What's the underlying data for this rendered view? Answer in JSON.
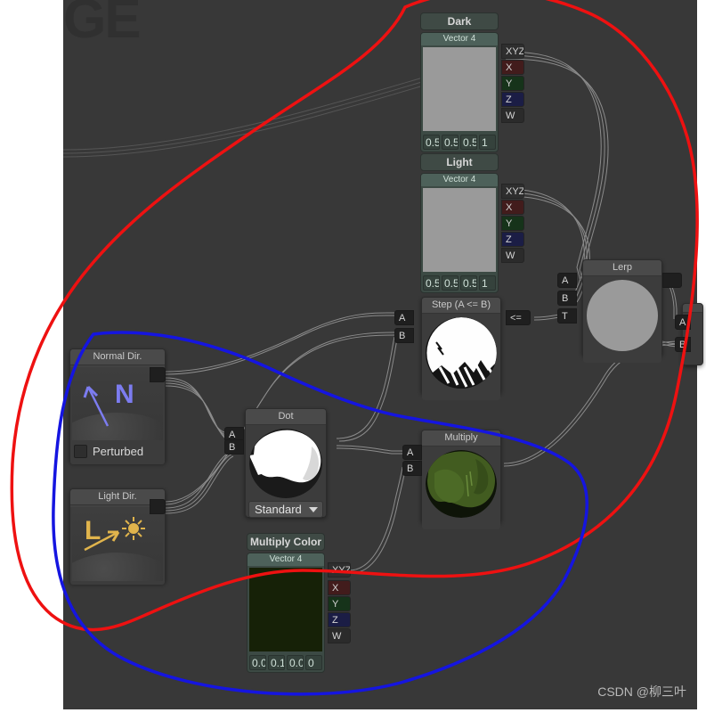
{
  "canvas": {
    "background_color": "#383838",
    "watermark_ge": "GE",
    "watermark_csdn": "CSDN @柳三叶"
  },
  "annotations": {
    "red_color": "#ee1111",
    "blue_color": "#1515e0"
  },
  "nodes": {
    "dark": {
      "title": "Dark",
      "subtitle": "Vector 4",
      "fields": [
        "0.5",
        "0.5",
        "0.5",
        "1"
      ],
      "outputs": [
        "XYZ",
        "X",
        "Y",
        "Z",
        "W"
      ]
    },
    "light": {
      "title": "Light",
      "subtitle": "Vector 4",
      "fields": [
        "0.5",
        "0.5",
        "0.5",
        "1"
      ],
      "outputs": [
        "XYZ",
        "X",
        "Y",
        "Z",
        "W"
      ]
    },
    "multiply_color": {
      "title": "Multiply Color",
      "subtitle": "Vector 4",
      "fields": [
        "0.0",
        "0.1(",
        "0.0",
        "0"
      ],
      "outputs": [
        "XYZ",
        "X",
        "Y",
        "Z",
        "W"
      ],
      "swatch_color": "#162107"
    },
    "step": {
      "title": "Step (A <= B)",
      "inputs": [
        "A",
        "B"
      ],
      "outputs": [
        "<="
      ]
    },
    "lerp": {
      "title": "Lerp",
      "inputs": [
        "A",
        "B",
        "T"
      ],
      "outputs": [
        ""
      ]
    },
    "dot": {
      "title": "Dot",
      "inputs": [
        "A",
        "B"
      ],
      "dropdown_value": "Standard"
    },
    "multiply": {
      "title": "Multiply",
      "inputs": [
        "A",
        "B"
      ]
    },
    "normal_dir": {
      "title": "Normal Dir.",
      "glyph": "N",
      "checkbox_label": "Perturbed",
      "checkbox_checked": false,
      "accent_color": "#7c7cf0"
    },
    "light_dir": {
      "title": "Light Dir.",
      "glyph": "L",
      "icon": "sun-icon",
      "accent_color": "#e0b44c"
    },
    "offscreen": {
      "inputs": [
        "A",
        "B"
      ]
    }
  }
}
